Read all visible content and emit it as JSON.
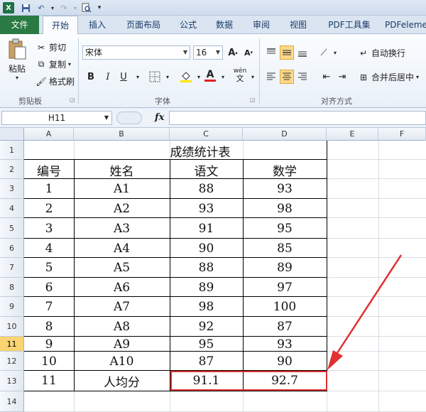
{
  "titlebar": {
    "logo": "X",
    "save_icon": "save-icon",
    "undo_icon": "undo-icon",
    "redo_icon": "redo-icon",
    "preview_icon": "print-preview-icon"
  },
  "tabs": [
    "文件",
    "开始",
    "插入",
    "页面布局",
    "公式",
    "数据",
    "审阅",
    "视图",
    "PDF工具集",
    "PDFeleme"
  ],
  "ribbon": {
    "clipboard": {
      "paste": "粘贴",
      "cut": "剪切",
      "copy": "复制",
      "format_painter": "格式刷",
      "label": "剪贴板"
    },
    "font": {
      "name": "宋体",
      "size": "16",
      "bold": "B",
      "italic": "I",
      "underline": "U",
      "wen": "wén",
      "label": "字体"
    },
    "align": {
      "wrap": "自动换行",
      "merge": "合并后居中",
      "label": "对齐方式"
    }
  },
  "formula_bar": {
    "name_box": "H11",
    "fx": "fx",
    "value": ""
  },
  "columns": [
    "A",
    "B",
    "C",
    "D",
    "E",
    "F"
  ],
  "rows": [
    "1",
    "2",
    "3",
    "4",
    "5",
    "6",
    "7",
    "8",
    "9",
    "10",
    "11",
    "12",
    "13",
    "14"
  ],
  "selected_row": "11",
  "table": {
    "title": "成绩统计表",
    "headers": [
      "编号",
      "姓名",
      "语文",
      "数学"
    ],
    "data": [
      [
        "1",
        "A1",
        "88",
        "93"
      ],
      [
        "2",
        "A2",
        "93",
        "98"
      ],
      [
        "3",
        "A3",
        "91",
        "95"
      ],
      [
        "4",
        "A4",
        "90",
        "85"
      ],
      [
        "5",
        "A5",
        "88",
        "89"
      ],
      [
        "6",
        "A6",
        "89",
        "97"
      ],
      [
        "7",
        "A7",
        "98",
        "100"
      ],
      [
        "8",
        "A8",
        "92",
        "87"
      ],
      [
        "9",
        "A9",
        "95",
        "93"
      ],
      [
        "10",
        "A10",
        "87",
        "90"
      ]
    ],
    "summary": [
      "11",
      "人均分",
      "91.1",
      "92.7"
    ]
  },
  "colors": {
    "highlight_box": "#e03030",
    "arrow": "#e03030",
    "file_tab": "#2a7a43"
  }
}
